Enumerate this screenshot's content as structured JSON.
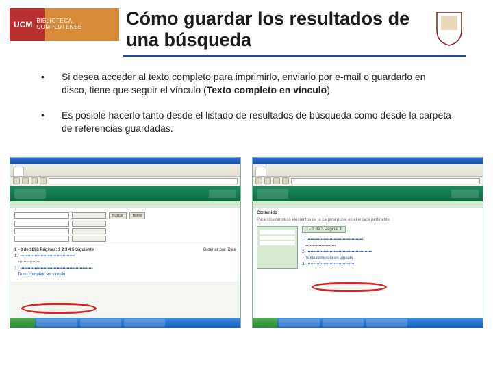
{
  "header": {
    "logo_ucm_prefix": "UCM",
    "logo_ucm_lines": "BIBLIOTECA COMPLUTENSE",
    "title": "Cómo guardar los resultados de una búsqueda"
  },
  "bullets": [
    {
      "dot": "•",
      "text_before": "Si desea acceder al texto completo para imprimirlo, enviarlo por e-mail o guardarlo en disco, tiene que seguir el vínculo (",
      "bold": "Texto completo en vínculo",
      "after": ")."
    },
    {
      "dot": "•",
      "text_before": "Es posible hacerlo tanto desde el listado de resultados de búsqueda como desde la carpeta de referencias guardadas.",
      "bold": "",
      "after": ""
    }
  ],
  "screenshots": {
    "left": {
      "buttons": {
        "buscar": "Buscar",
        "borrar": "Borrar"
      },
      "results_header": "1 - 8 de 1898  Páginas: 1 2 3 4 5  Siguiente",
      "ordenar": "Ordenar por:  Date",
      "circled_label": "Texto completo en vínculo"
    },
    "right": {
      "contenido": "Contenido",
      "contenido_sub": "Para mostrar otros elementos de la carpeta pulse en el enlace pertinente.",
      "tab1": "1 - 3 de 3  Página: 1",
      "circled_label": "Texto completo en vínculo"
    }
  }
}
